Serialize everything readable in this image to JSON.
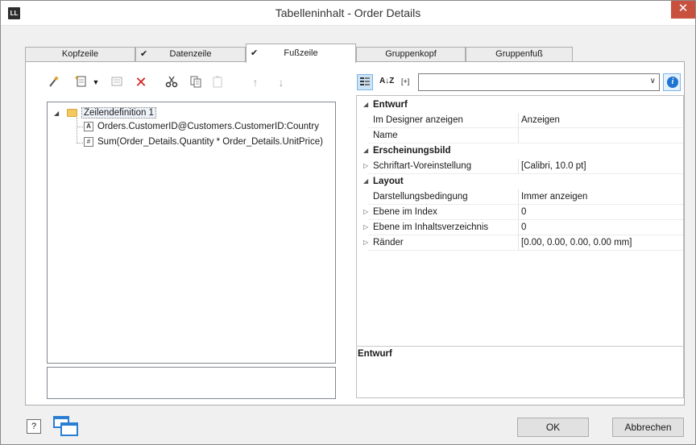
{
  "window": {
    "app_icon": "LL",
    "title": "Tabelleninhalt - Order Details",
    "close_glyph": "✕"
  },
  "tabs": [
    {
      "label": "Kopfzeile",
      "checked": false,
      "active": false
    },
    {
      "label": "Datenzeile",
      "checked": true,
      "active": false
    },
    {
      "label": "Fußzeile",
      "checked": true,
      "active": true
    },
    {
      "label": "Gruppenkopf",
      "checked": false,
      "active": false
    },
    {
      "label": "Gruppenfuß",
      "checked": false,
      "active": false
    }
  ],
  "check_glyph": "✔",
  "left_toolbar": {
    "icons": [
      "magic-wand-icon",
      "new-item-icon",
      "dropdown-icon",
      "properties-icon",
      "delete-icon",
      "cut-icon",
      "copy-icon",
      "paste-icon",
      "arrow-up-icon",
      "arrow-down-icon"
    ]
  },
  "tree": {
    "root": {
      "label": "Zeilendefinition  1"
    },
    "children": [
      {
        "label": "Orders.CustomerID@Customers.CustomerID:Country",
        "icon": "A"
      },
      {
        "label": "Sum(Order_Details.Quantity * Order_Details.UnitPrice)",
        "icon": "#"
      }
    ]
  },
  "property_toolbar": {
    "sort_label": "A↓Z",
    "expand_label": "[+]",
    "combo_value": "",
    "info_glyph": "i"
  },
  "properties": {
    "entwurf": {
      "label": "Entwurf",
      "rows": [
        {
          "name": "Im Designer anzeigen",
          "value": "Anzeigen"
        },
        {
          "name": "Name",
          "value": ""
        }
      ]
    },
    "erscheinungsbild": {
      "label": "Erscheinungsbild",
      "rows": [
        {
          "name": "Schriftart-Voreinstellung",
          "value": "[Calibri, 10.0 pt]"
        }
      ]
    },
    "layout": {
      "label": "Layout",
      "rows": [
        {
          "name": "Darstellungsbedingung",
          "value": "Immer anzeigen"
        },
        {
          "name": "Ebene im Index",
          "value": "0"
        },
        {
          "name": "Ebene im Inhaltsverzeichnis",
          "value": "0"
        },
        {
          "name": "Ränder",
          "value": "[0.00, 0.00, 0.00, 0.00 mm]"
        }
      ]
    }
  },
  "description": {
    "title": "Entwurf"
  },
  "buttons": {
    "ok": "OK",
    "cancel": "Abbrechen",
    "help": "?"
  }
}
